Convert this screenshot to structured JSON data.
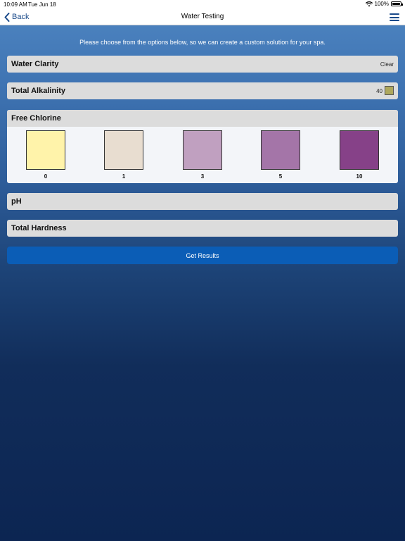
{
  "status": {
    "time": "10:09 AM",
    "date": "Tue Jun 18",
    "battery": "100%"
  },
  "nav": {
    "back_label": "Back",
    "title": "Water Testing"
  },
  "instructions": "Please choose from the options below, so we can create a custom solution for your spa.",
  "rows": {
    "water_clarity": {
      "label": "Water Clarity",
      "value": "Clear"
    },
    "total_alkalinity": {
      "label": "Total Alkalinity",
      "value": "40",
      "swatch_color": "#aea85d"
    },
    "ph": {
      "label": "pH"
    },
    "total_hardness": {
      "label": "Total Hardness"
    }
  },
  "free_chlorine": {
    "label": "Free Chlorine",
    "options": [
      {
        "label": "0",
        "color": "#fff3aa"
      },
      {
        "label": "1",
        "color": "#e8ddd0"
      },
      {
        "label": "3",
        "color": "#c0a0c0"
      },
      {
        "label": "5",
        "color": "#a475a8"
      },
      {
        "label": "10",
        "color": "#864188"
      }
    ]
  },
  "results_button": "Get Results",
  "colors": {
    "accent": "#0b5db6",
    "nav_text": "#1a4a8a"
  }
}
